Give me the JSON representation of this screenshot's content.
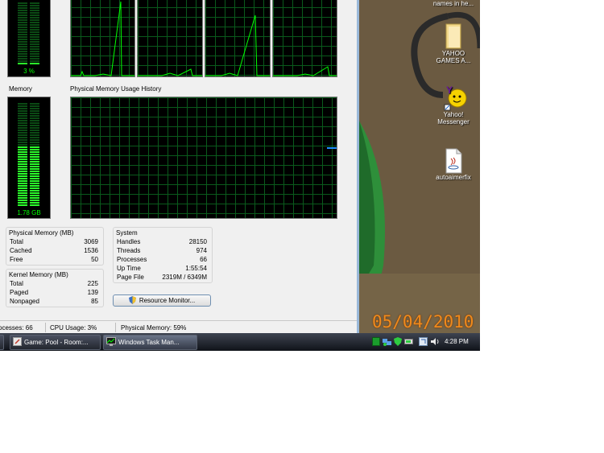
{
  "cpu": {
    "meter_label": "3 %",
    "meter_level": 0.03
  },
  "memory": {
    "section_label": "Memory",
    "meter_label": "1.78 GB",
    "meter_level": 0.59,
    "history_title": "Physical Memory Usage History"
  },
  "physical_memory": {
    "title": "Physical Memory (MB)",
    "rows": [
      {
        "k": "Total",
        "v": "3069"
      },
      {
        "k": "Cached",
        "v": "1536"
      },
      {
        "k": "Free",
        "v": "50"
      }
    ]
  },
  "kernel_memory": {
    "title": "Kernel Memory (MB)",
    "rows": [
      {
        "k": "Total",
        "v": "225"
      },
      {
        "k": "Paged",
        "v": "139"
      },
      {
        "k": "Nonpaged",
        "v": "85"
      }
    ]
  },
  "system": {
    "title": "System",
    "rows": [
      {
        "k": "Handles",
        "v": "28150"
      },
      {
        "k": "Threads",
        "v": "974"
      },
      {
        "k": "Processes",
        "v": "66"
      },
      {
        "k": "Up Time",
        "v": "1:55:54"
      },
      {
        "k": "Page File",
        "v": "2319M / 6349M"
      }
    ]
  },
  "resource_monitor_label": "Resource Monitor...",
  "status": {
    "processes": "ocesses: 66",
    "cpu": "CPU Usage: 3%",
    "memory": "Physical Memory: 59%"
  },
  "taskbar": {
    "tasks": [
      {
        "label": "Game: Pool - Room:..."
      },
      {
        "label": "Windows Task Man..."
      }
    ],
    "clock": "4:28 PM"
  },
  "desktop": {
    "icons": [
      {
        "label": "names in he..."
      },
      {
        "label": "YAHOO GAMES A..."
      },
      {
        "label": "Yahoo! Messenger"
      },
      {
        "label": "autoaimerfix"
      }
    ],
    "date_stamp": "05/04/2010"
  },
  "colors": {
    "graph_line": "#00ff00",
    "memory_line": "#1e90ff",
    "date_stamp": "#f08a1c"
  }
}
